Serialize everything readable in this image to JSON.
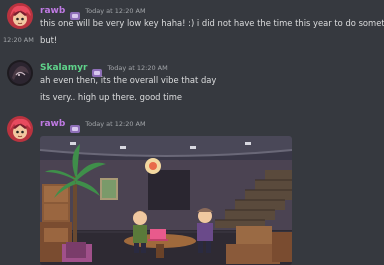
{
  "messages": [
    {
      "author": "rawb",
      "timestamp": "Today at 12:20 AM",
      "lines": [
        "this one will be very low key haha! :) i did not have the time this year to do something",
        "but!"
      ],
      "hover_time": "12:20 AM"
    },
    {
      "author": "Skalamyr",
      "timestamp": "Today at 12:20 AM",
      "lines": [
        "ah even then, its the overall vibe that day",
        "its very.. high up there. good time"
      ]
    },
    {
      "author": "rawb",
      "timestamp": "Today at 12:20 AM",
      "attachment": "image"
    }
  ],
  "colors": {
    "background": "#36393f",
    "username_rawb": "#bf7ae3",
    "username_skalamyr": "#5fd48b",
    "text": "#dcddde",
    "timestamp": "#a3a6aa"
  },
  "icons": [
    "role-badge-icon"
  ]
}
